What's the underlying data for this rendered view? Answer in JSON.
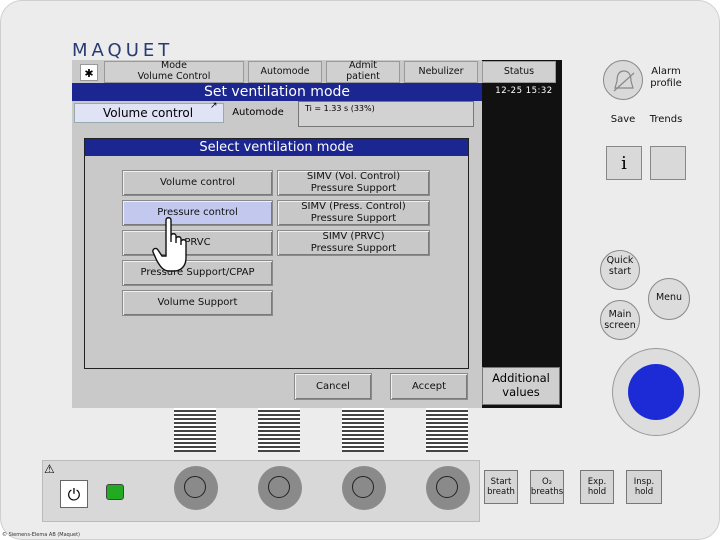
{
  "brand": "MAQUET",
  "copyright": "© Siemens-Elema AB (Maquet)",
  "top_bar": {
    "mode_button": "Mode\nVolume Control",
    "automode_button": "Automode",
    "admit_button": "Admit\npatient",
    "nebulizer_button": "Nebulizer",
    "status_button": "Status",
    "datetime": "12-25 15:32",
    "alarm_profile": "Alarm\nprofile",
    "save": "Save",
    "trends": "Trends"
  },
  "set_mode": {
    "title": "Set ventilation mode",
    "current_mode": "Volume control",
    "automode": "Automode",
    "ti_info": "Ti = 1.33 s  (33%)"
  },
  "select_dialog": {
    "title": "Select ventilation mode",
    "left_modes": [
      "Volume control",
      "Pressure control",
      "PRVC",
      "Pressure Support/CPAP",
      "Volume Support"
    ],
    "right_modes": [
      "SIMV (Vol. Control)\nPressure Support",
      "SIMV (Press. Control)\nPressure Support",
      "SIMV (PRVC)\nPressure Support"
    ],
    "selected": "Pressure control",
    "cancel": "Cancel",
    "accept": "Accept"
  },
  "side_panel": {
    "info": "i",
    "quick_start": "Quick\nstart",
    "menu": "Menu",
    "main_screen": "Main\nscreen",
    "additional_values": "Additional\nvalues"
  },
  "bottom_keys": {
    "start_breath": "Start\nbreath",
    "o2_breaths": "O₂\nbreaths",
    "exp_hold": "Exp.\nhold",
    "insp_hold": "Insp.\nhold"
  },
  "colors": {
    "header_blue": "#1c2690",
    "selected_button": "#c2c8ee",
    "device_gray": "#ececec"
  }
}
